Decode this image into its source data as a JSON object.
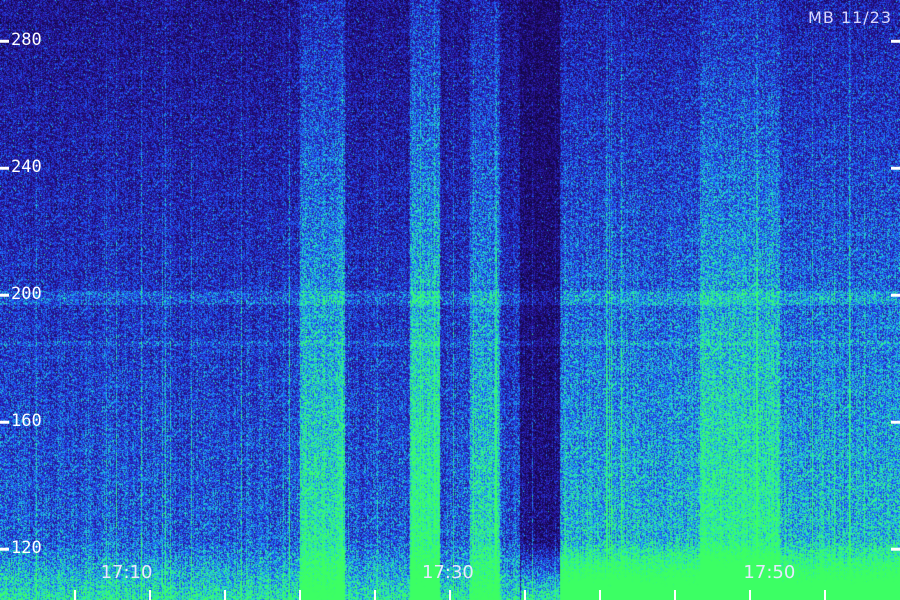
{
  "corner_label": "MB 11/23",
  "colors": {
    "background": "#1a0a5e",
    "low": "#2a14a0",
    "mid": "#1e5cff",
    "high": "#22e0c8",
    "peak": "#33ff66",
    "axis": "#ffffff"
  },
  "chart_data": {
    "type": "heatmap",
    "title": "",
    "xlabel": "",
    "ylabel": "",
    "y_ticks": [
      120,
      160,
      200,
      240,
      280
    ],
    "ylim": [
      104,
      293
    ],
    "x_ticks": [
      "17:10",
      "17:30",
      "17:50"
    ],
    "x_range": [
      "17:02",
      "17:58"
    ],
    "grid": false,
    "legend": "none"
  }
}
